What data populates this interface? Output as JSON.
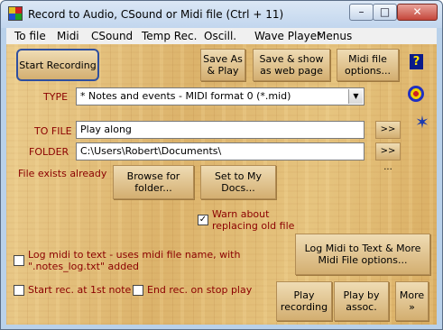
{
  "window": {
    "title": "Record to Audio, CSound or Midi file (Ctrl + 11)"
  },
  "menu": [
    {
      "label": "To file"
    },
    {
      "label": "Midi"
    },
    {
      "label": "CSound"
    },
    {
      "label": "Temp Rec."
    },
    {
      "label": "Oscill."
    },
    {
      "label": "Wave Player"
    },
    {
      "label": "Menus"
    }
  ],
  "toolbar": {
    "start_recording": "Start Recording",
    "save_as_play": "Save As & Play",
    "save_show_web": "Save & show as web page",
    "midi_file_options": "Midi file options...",
    "help_icon_text": "?"
  },
  "type": {
    "label": "TYPE",
    "value": "* Notes and events - MIDI format 0 (*.mid)"
  },
  "to_file": {
    "label": "TO FILE",
    "value": "Play along",
    "browse": ">> ..."
  },
  "folder": {
    "label": "FOLDER",
    "value": "C:\\Users\\Robert\\Documents\\",
    "browse": ">> ..."
  },
  "status": {
    "file_exists": "File exists already"
  },
  "folder_buttons": {
    "browse_folder": "Browse for folder...",
    "set_my_docs": "Set to My Docs..."
  },
  "warn": {
    "label": "Warn about replacing old file",
    "checked": true
  },
  "log_midi": {
    "label": "Log midi to text - uses midi file name, with \".notes_log.txt\" added",
    "checked": false
  },
  "log_midi_options": "Log Midi to Text & More Midi File options...",
  "start_rec_first_note": {
    "label": "Start rec. at 1st note",
    "checked": false
  },
  "end_rec_stop_play": {
    "label": "End rec. on stop play",
    "checked": false
  },
  "bottom_buttons": {
    "play_recording": "Play recording",
    "play_by_assoc": "Play by assoc.",
    "more": "More »"
  },
  "colors": {
    "label_red": "#8b0000",
    "wood": "#e3c07d",
    "accent_blue": "#2f4f9f"
  }
}
